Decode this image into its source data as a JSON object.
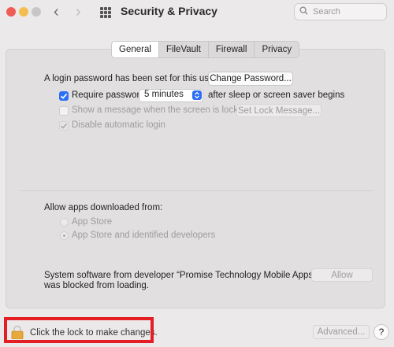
{
  "window": {
    "title": "Security & Privacy",
    "search_placeholder": "Search"
  },
  "tabs": [
    {
      "label": "General",
      "active": true
    },
    {
      "label": "FileVault",
      "active": false
    },
    {
      "label": "Firewall",
      "active": false
    },
    {
      "label": "Privacy",
      "active": false
    }
  ],
  "general": {
    "login_password_text": "A login password has been set for this user",
    "change_password_button": "Change Password...",
    "require_password_label": "Require password",
    "require_password_checked": true,
    "require_password_value": "5 minutes",
    "after_sleep_text": "after sleep or screen saver begins",
    "show_message_label": "Show a message when the screen is locked",
    "set_lock_message_button": "Set Lock Message...",
    "disable_auto_login_label": "Disable automatic login"
  },
  "downloads": {
    "heading": "Allow apps downloaded from:",
    "options": [
      {
        "label": "App Store",
        "selected": false
      },
      {
        "label": "App Store and identified developers",
        "selected": true
      }
    ]
  },
  "blocked": {
    "line1": "System software from developer “Promise Technology Mobile Apps”",
    "line2": "was blocked from loading.",
    "allow_button": "Allow"
  },
  "footer": {
    "lock_text": "Click the lock to make changes.",
    "advanced_button": "Advanced...",
    "help_button": "?"
  },
  "colors": {
    "accent": "#2b6ff5",
    "highlight": "#e31e24",
    "lock": "#e8a93a"
  }
}
